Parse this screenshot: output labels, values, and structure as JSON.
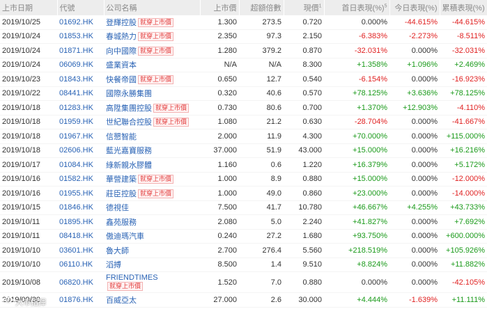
{
  "headers": {
    "date": "上市日期",
    "code": "代號",
    "name": "公司名稱",
    "price": "上市價",
    "oversub": "超額倍數",
    "current": "現價",
    "current_sup": "1",
    "first_day": "首日表現(%)",
    "first_day_sup": "5",
    "today": "今日表現(%)",
    "cumulative": "累積表現(%)"
  },
  "badge_text": "就穿上市價",
  "rows": [
    {
      "date": "2019/10/25",
      "code": "01692.HK",
      "name": "登輝控股",
      "badge": true,
      "price": "1.300",
      "oversub": "273.5",
      "current": "0.720",
      "first": "0.000%",
      "today": "-44.615%",
      "cum": "-44.615%"
    },
    {
      "date": "2019/10/24",
      "code": "01853.HK",
      "name": "春城熱力",
      "badge": true,
      "price": "2.350",
      "oversub": "97.3",
      "current": "2.150",
      "first": "-6.383%",
      "today": "-2.273%",
      "cum": "-8.511%"
    },
    {
      "date": "2019/10/24",
      "code": "01871.HK",
      "name": "向中國際",
      "badge": true,
      "price": "1.280",
      "oversub": "379.2",
      "current": "0.870",
      "first": "-32.031%",
      "today": "0.000%",
      "cum": "-32.031%"
    },
    {
      "date": "2019/10/24",
      "code": "06069.HK",
      "name": "盛業資本",
      "badge": false,
      "price": "N/A",
      "oversub": "N/A",
      "current": "8.300",
      "first": "+1.358%",
      "today": "+1.096%",
      "cum": "+2.469%"
    },
    {
      "date": "2019/10/23",
      "code": "01843.HK",
      "name": "快餐帝國",
      "badge": true,
      "price": "0.650",
      "oversub": "12.7",
      "current": "0.540",
      "first": "-6.154%",
      "today": "0.000%",
      "cum": "-16.923%"
    },
    {
      "date": "2019/10/22",
      "code": "08441.HK",
      "name": "國際永勝集團",
      "badge": false,
      "price": "0.320",
      "oversub": "40.6",
      "current": "0.570",
      "first": "+78.125%",
      "today": "+3.636%",
      "cum": "+78.125%"
    },
    {
      "date": "2019/10/18",
      "code": "01283.HK",
      "name": "高陞集團控股",
      "badge": true,
      "price": "0.730",
      "oversub": "80.6",
      "current": "0.700",
      "first": "+1.370%",
      "today": "+12.903%",
      "cum": "-4.110%"
    },
    {
      "date": "2019/10/18",
      "code": "01959.HK",
      "name": "世紀聯合控股",
      "badge": true,
      "price": "1.080",
      "oversub": "21.2",
      "current": "0.630",
      "first": "-28.704%",
      "today": "0.000%",
      "cum": "-41.667%"
    },
    {
      "date": "2019/10/18",
      "code": "01967.HK",
      "name": "信懇智能",
      "badge": false,
      "price": "2.000",
      "oversub": "11.9",
      "current": "4.300",
      "first": "+70.000%",
      "today": "0.000%",
      "cum": "+115.000%"
    },
    {
      "date": "2019/10/18",
      "code": "02606.HK",
      "name": "藍光嘉寶服務",
      "badge": false,
      "price": "37.000",
      "oversub": "51.9",
      "current": "43.000",
      "first": "+15.000%",
      "today": "0.000%",
      "cum": "+16.216%"
    },
    {
      "date": "2019/10/17",
      "code": "01084.HK",
      "name": "綠新親水膠體",
      "badge": false,
      "price": "1.160",
      "oversub": "0.6",
      "current": "1.220",
      "first": "+16.379%",
      "today": "0.000%",
      "cum": "+5.172%"
    },
    {
      "date": "2019/10/16",
      "code": "01582.HK",
      "name": "華營建築",
      "badge": true,
      "price": "1.000",
      "oversub": "8.9",
      "current": "0.880",
      "first": "+15.000%",
      "today": "0.000%",
      "cum": "-12.000%"
    },
    {
      "date": "2019/10/16",
      "code": "01955.HK",
      "name": "莊臣控股",
      "badge": true,
      "price": "1.000",
      "oversub": "49.0",
      "current": "0.860",
      "first": "+23.000%",
      "today": "0.000%",
      "cum": "-14.000%"
    },
    {
      "date": "2019/10/15",
      "code": "01846.HK",
      "name": "德視佳",
      "badge": false,
      "price": "7.500",
      "oversub": "41.7",
      "current": "10.780",
      "first": "+46.667%",
      "today": "+4.255%",
      "cum": "+43.733%"
    },
    {
      "date": "2019/10/11",
      "code": "01895.HK",
      "name": "鑫苑服務",
      "badge": false,
      "price": "2.080",
      "oversub": "5.0",
      "current": "2.240",
      "first": "+41.827%",
      "today": "0.000%",
      "cum": "+7.692%"
    },
    {
      "date": "2019/10/11",
      "code": "08418.HK",
      "name": "傲迪瑪汽車",
      "badge": false,
      "price": "0.240",
      "oversub": "27.2",
      "current": "1.680",
      "first": "+93.750%",
      "today": "0.000%",
      "cum": "+600.000%"
    },
    {
      "date": "2019/10/10",
      "code": "03601.HK",
      "name": "魯大師",
      "badge": false,
      "price": "2.700",
      "oversub": "276.4",
      "current": "5.560",
      "first": "+218.519%",
      "today": "0.000%",
      "cum": "+105.926%"
    },
    {
      "date": "2019/10/10",
      "code": "06110.HK",
      "name": "滔搏",
      "badge": false,
      "price": "8.500",
      "oversub": "1.4",
      "current": "9.510",
      "first": "+8.824%",
      "today": "0.000%",
      "cum": "+11.882%"
    },
    {
      "date": "2019/10/08",
      "code": "06820.HK",
      "name": "FRIENDTIMES",
      "badge": true,
      "twoline": true,
      "price": "1.520",
      "oversub": "7.0",
      "current": "0.880",
      "first": "0.000%",
      "today": "0.000%",
      "cum": "-42.105%"
    },
    {
      "date": "2019/09/30",
      "code": "01876.HK",
      "name": "百威亞太",
      "badge": false,
      "price": "27.000",
      "oversub": "2.6",
      "current": "30.000",
      "first": "+4.444%",
      "today": "-1.639%",
      "cum": "+11.111%"
    }
  ],
  "watermark": "大市指揮"
}
